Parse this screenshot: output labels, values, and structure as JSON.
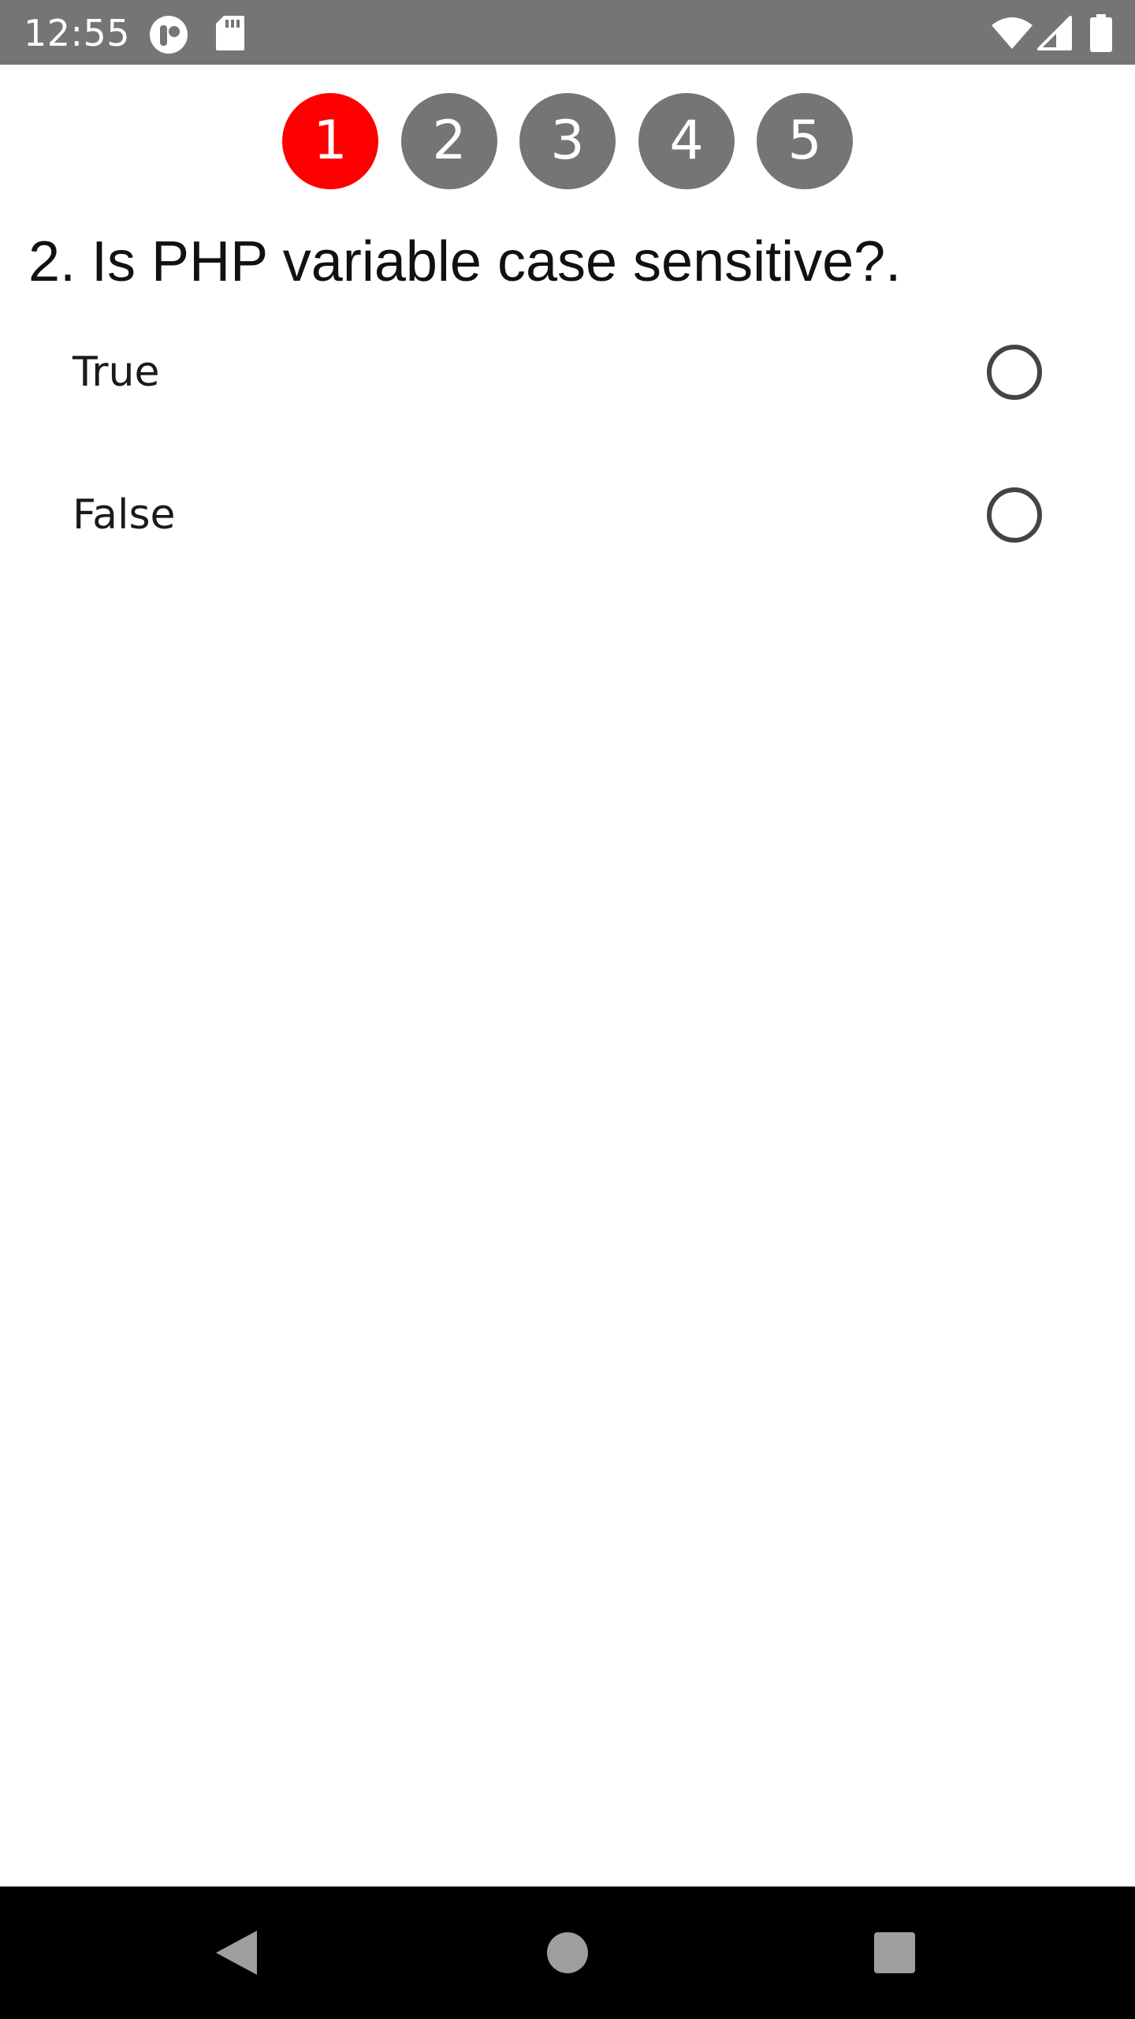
{
  "status_bar": {
    "time": "12:55",
    "icons": [
      "pocket-casts-icon",
      "sd-card-icon",
      "wifi-icon",
      "cell-signal-icon",
      "battery-icon"
    ]
  },
  "stepper": {
    "steps": [
      {
        "label": "1",
        "active": true
      },
      {
        "label": "2",
        "active": false
      },
      {
        "label": "3",
        "active": false
      },
      {
        "label": "4",
        "active": false
      },
      {
        "label": "5",
        "active": false
      }
    ],
    "colors": {
      "active": "#ff0000",
      "inactive": "#757575"
    }
  },
  "question": {
    "text": "2. Is PHP variable case sensitive?."
  },
  "options": [
    {
      "label": "True",
      "selected": false
    },
    {
      "label": "False",
      "selected": false
    }
  ],
  "nav_bar": {
    "buttons": [
      "back-icon",
      "home-icon",
      "recents-icon"
    ]
  }
}
